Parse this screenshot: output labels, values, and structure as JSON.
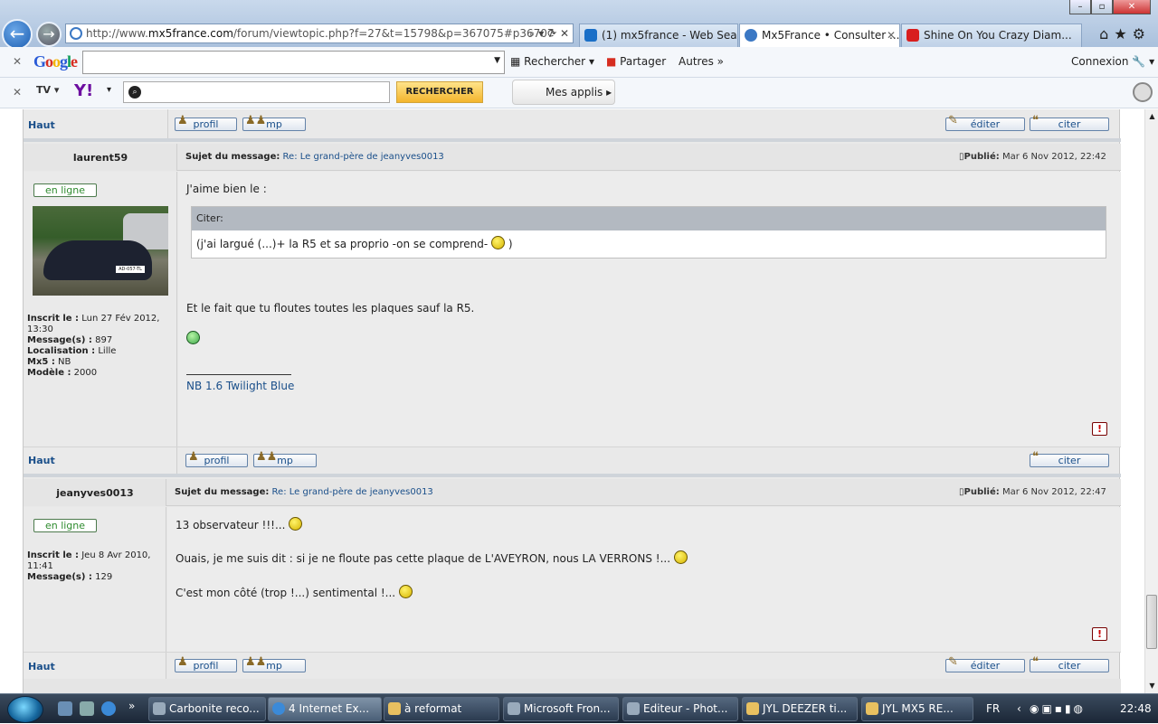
{
  "browser": {
    "address": "http://www.mx5france.com/forum/viewtopic.php?f=27&t=15798&p=367075#p36707",
    "address_prefix": "http://www.",
    "address_domain": "mx5france.com",
    "address_rest": "/forum/viewtopic.php?f=27&t=15798&p=367075#p36707",
    "tabs": [
      {
        "label": "(1) mx5france - Web Searc...",
        "icon": "bing-icon"
      },
      {
        "label": "Mx5France • Consulter ...",
        "icon": "ie-icon"
      },
      {
        "label": "Shine On You Crazy Diam...",
        "icon": "youtube-icon"
      }
    ]
  },
  "google_toolbar": {
    "logo": "Google",
    "search_value": "",
    "search_button": "Rechercher",
    "share_button": "Partager",
    "more_button": "Autres »",
    "connect": "Connexion"
  },
  "yahoo_toolbar": {
    "logo": "Y!",
    "search_value": "",
    "search_button": "RECHERCHER",
    "apps_button": "Mes applis"
  },
  "forum": {
    "top": {
      "haut": "Haut",
      "profil": "profil",
      "mp": "mp",
      "editer": "éditer",
      "citer": "citer"
    },
    "post1": {
      "author": "laurent59",
      "status": "en ligne",
      "subject_label": "Sujet du message:",
      "subject": "Re: Le grand-père de jeanyves0013",
      "published_label": "Publié:",
      "published": "Mar 6 Nov 2012, 22:42",
      "inscrit_label": "Inscrit le :",
      "inscrit": "Lun 27 Fév 2012, 13:30",
      "messages_label": "Message(s) :",
      "messages": "897",
      "localisation_label": "Localisation :",
      "localisation": "Lille",
      "mx5_label": "Mx5 :",
      "mx5": "NB",
      "modele_label": "Modèle :",
      "modele": "2000",
      "plate": "AD-057-TL",
      "line1": "J'aime bien le :",
      "quote_header": "Citer:",
      "quote_text": "(j'ai largué (...)+ la R5 et sa proprio -on se comprend-",
      "quote_end": ")",
      "line2": "Et le fait que tu floutes toutes les plaques sauf la R5.",
      "signature": "NB 1.6 Twilight Blue",
      "haut": "Haut",
      "profil": "profil",
      "mp": "mp",
      "citer": "citer",
      "report": "!"
    },
    "post2": {
      "author": "jeanyves0013",
      "status": "en ligne",
      "subject_label": "Sujet du message:",
      "subject": "Re: Le grand-père de jeanyves0013",
      "published_label": "Publié:",
      "published": "Mar 6 Nov 2012, 22:47",
      "inscrit_label": "Inscrit le :",
      "inscrit": "Jeu 8 Avr 2010, 11:41",
      "messages_label": "Message(s) :",
      "messages": "129",
      "line1": "13 observateur !!!...",
      "line2": "Ouais, je me suis dit : si je ne floute pas cette plaque de L'AVEYRON, nous LA VERRONS !...",
      "line3": "C'est mon côté (trop !...) sentimental !...",
      "haut": "Haut",
      "profil": "profil",
      "mp": "mp",
      "editer": "éditer",
      "citer": "citer",
      "report": "!"
    }
  },
  "taskbar": {
    "buttons": [
      {
        "label": "Carbonite reco..."
      },
      {
        "label": "4 Internet Ex..."
      },
      {
        "label": "à reformat"
      },
      {
        "label": "Microsoft Fron..."
      },
      {
        "label": "Editeur - Phot..."
      },
      {
        "label": "JYL   DEEZER ti..."
      },
      {
        "label": "JYL   MX5   RE..."
      }
    ],
    "lang": "FR",
    "time": "22:48"
  }
}
